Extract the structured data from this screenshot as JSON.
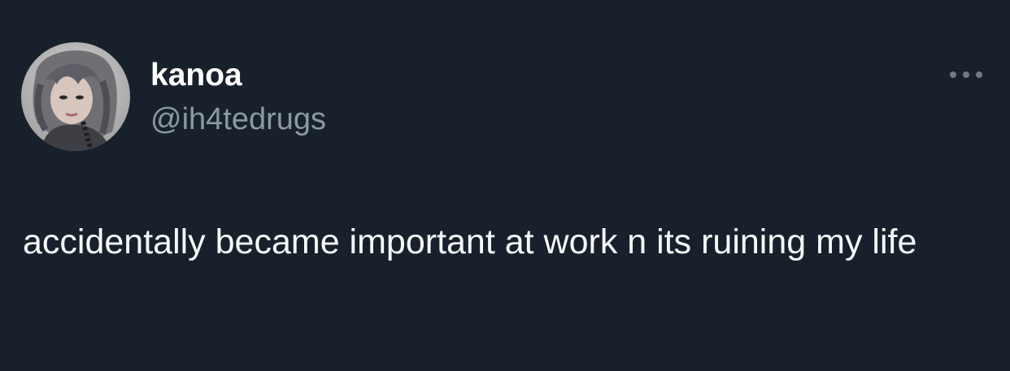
{
  "tweet": {
    "author": {
      "display_name": "kanoa",
      "handle": "@ih4tedrugs"
    },
    "text": "accidentally became important at work n its ruining my life",
    "more_icon": "more-horizontal-icon",
    "avatar_icon": "profile-photo"
  },
  "colors": {
    "background": "#18212b",
    "display_name": "#ffffff",
    "handle": "#8b98a5",
    "body_text": "#f7f9f9",
    "icon_muted": "#6e7b86"
  }
}
